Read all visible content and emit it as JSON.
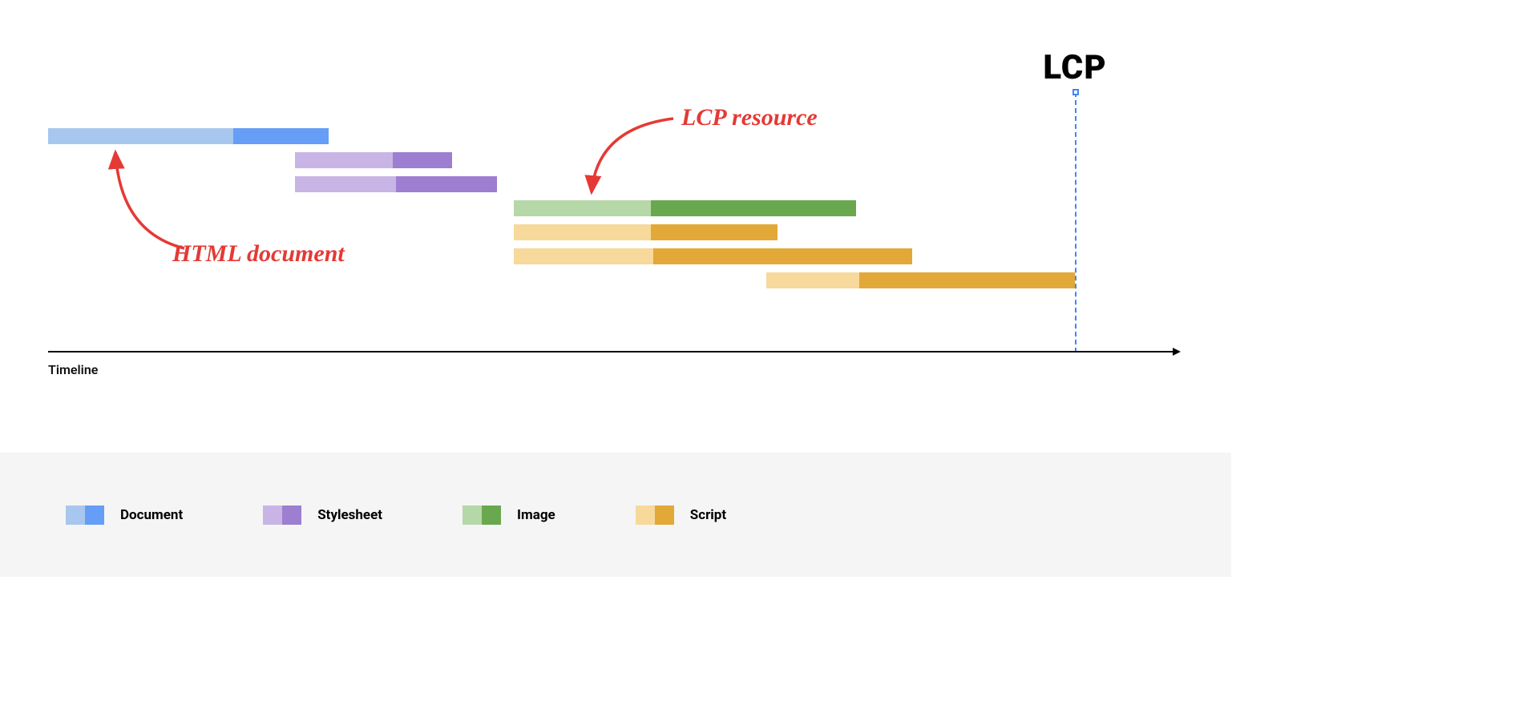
{
  "chart_data": {
    "type": "gantt",
    "title": "",
    "xlabel": "Timeline",
    "lcp_position_pct": 91.5,
    "bars": [
      {
        "row": 0,
        "type": "document",
        "start_pct": 0.0,
        "end_pct": 25.0,
        "light_fraction": 0.66
      },
      {
        "row": 1,
        "type": "stylesheet",
        "start_pct": 22.0,
        "end_pct": 36.0,
        "light_fraction": 0.62
      },
      {
        "row": 2,
        "type": "stylesheet",
        "start_pct": 22.0,
        "end_pct": 40.0,
        "light_fraction": 0.5
      },
      {
        "row": 3,
        "type": "image",
        "start_pct": 41.5,
        "end_pct": 72.0,
        "light_fraction": 0.4
      },
      {
        "row": 4,
        "type": "script",
        "start_pct": 41.5,
        "end_pct": 65.0,
        "light_fraction": 0.52
      },
      {
        "row": 5,
        "type": "script",
        "start_pct": 41.5,
        "end_pct": 77.0,
        "light_fraction": 0.35
      },
      {
        "row": 6,
        "type": "script",
        "start_pct": 64.0,
        "end_pct": 91.5,
        "light_fraction": 0.3
      }
    ],
    "colors": {
      "document": {
        "light": "#a8c7ee",
        "dark": "#669df6"
      },
      "stylesheet": {
        "light": "#c8b5e6",
        "dark": "#9d7ed1"
      },
      "image": {
        "light": "#b6d7a8",
        "dark": "#6aa84f"
      },
      "script": {
        "light": "#f6d99b",
        "dark": "#e2a838"
      }
    }
  },
  "lcp_label": "LCP",
  "axis_label": "Timeline",
  "annotations": {
    "html_document": "HTML document",
    "lcp_resource": "LCP resource"
  },
  "legend": {
    "items": [
      {
        "type": "document",
        "label": "Document"
      },
      {
        "type": "stylesheet",
        "label": "Stylesheet"
      },
      {
        "type": "image",
        "label": "Image"
      },
      {
        "type": "script",
        "label": "Script"
      }
    ]
  }
}
